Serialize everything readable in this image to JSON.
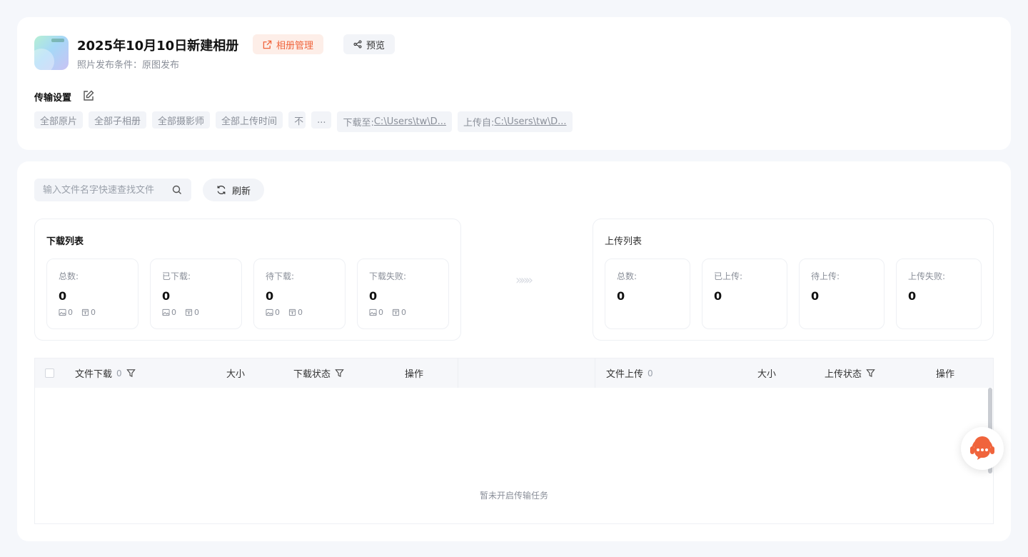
{
  "album": {
    "title": "2025年10月10日新建相册",
    "subtitle": "照片发布条件：原图发布",
    "manage_label": "相册管理",
    "preview_label": "预览"
  },
  "transfer_settings": {
    "label": "传输设置",
    "tags": [
      "全部原片",
      "全部子相册",
      "全部摄影师",
      "全部上传时间",
      "不",
      "..."
    ],
    "download_prefix": "下载至:",
    "download_path": "C:\\Users\\tw\\D...",
    "upload_prefix": "上传自:",
    "upload_path": "C:\\Users\\tw\\D..."
  },
  "toolbar": {
    "search_placeholder": "输入文件名字快速查找文件",
    "refresh_label": "刷新"
  },
  "download_panel": {
    "title": "下载列表",
    "stats": [
      {
        "label": "总数:",
        "value": "0",
        "images": "0",
        "files": "0"
      },
      {
        "label": "已下载:",
        "value": "0",
        "images": "0",
        "files": "0"
      },
      {
        "label": "待下载:",
        "value": "0",
        "images": "0",
        "files": "0"
      },
      {
        "label": "下载失败:",
        "value": "0",
        "images": "0",
        "files": "0"
      }
    ]
  },
  "arrows": "»»»",
  "upload_panel": {
    "title": "上传列表",
    "stats": [
      {
        "label": "总数:",
        "value": "0"
      },
      {
        "label": "已上传:",
        "value": "0"
      },
      {
        "label": "待上传:",
        "value": "0"
      },
      {
        "label": "上传失败:",
        "value": "0"
      }
    ]
  },
  "table": {
    "download_cols": {
      "file": "文件下载",
      "count": "0",
      "size": "大小",
      "status": "下载状态",
      "action": "操作"
    },
    "upload_cols": {
      "file": "文件上传",
      "count": "0",
      "size": "大小",
      "status": "上传状态",
      "action": "操作"
    },
    "empty_text": "暂未开启传输任务"
  },
  "icons": {
    "manage": "external-edit-icon",
    "preview": "share-icon",
    "edit": "edit-icon",
    "search": "search-icon",
    "refresh": "refresh-icon",
    "filter": "filter-icon",
    "image": "image-icon",
    "file": "file-icon",
    "support": "customer-service-icon"
  },
  "colors": {
    "accent": "#f0643c",
    "accent_bg": "#fdeee8",
    "page_bg": "#f5f7fb"
  }
}
